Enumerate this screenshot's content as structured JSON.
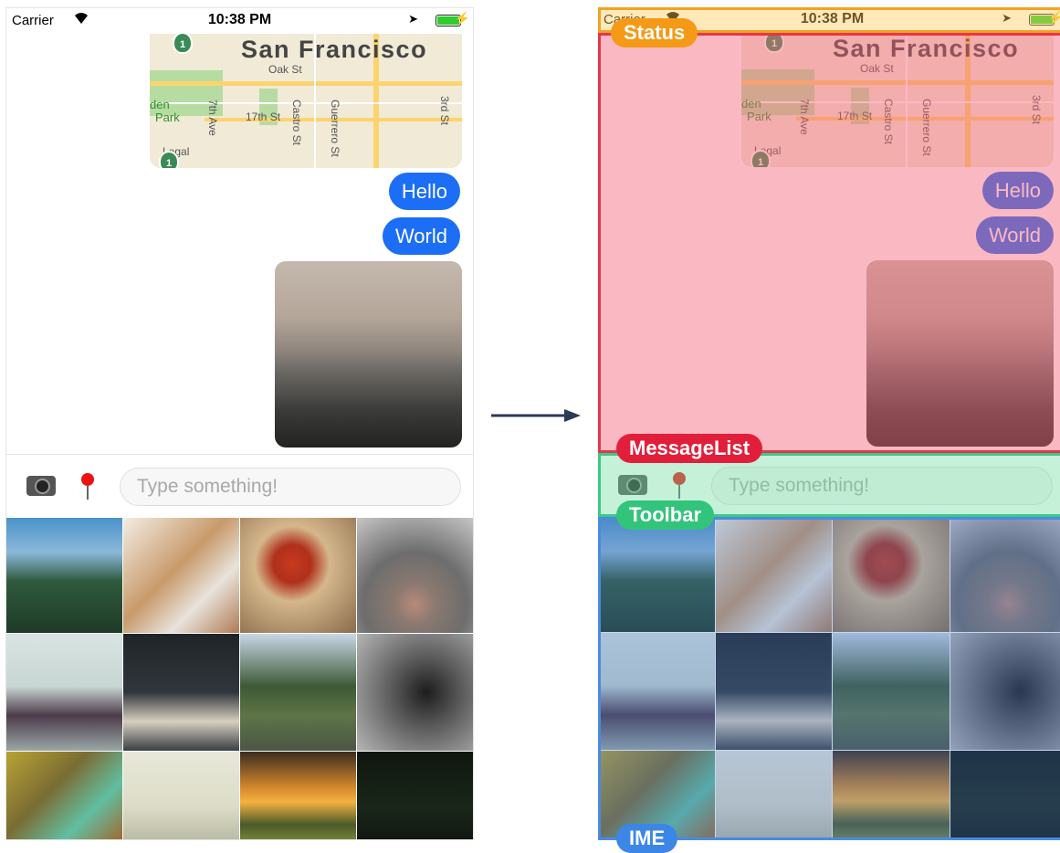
{
  "status": {
    "carrier": "Carrier",
    "time": "10:38 PM",
    "bolt": "⚡",
    "location_glyph": "➤"
  },
  "map": {
    "city": "San Francisco",
    "labels": {
      "oak": "Oak St",
      "seventeenth": "17th St",
      "seventh": "7th Ave",
      "castro": "Castro St",
      "guerrero": "Guerrero St",
      "third": "3rd St",
      "den": "den",
      "park": "Park",
      "legal": "Legal"
    },
    "shield": "1"
  },
  "messages": [
    {
      "text": "Hello"
    },
    {
      "text": "World"
    }
  ],
  "toolbar": {
    "placeholder": "Type something!"
  },
  "overlay_labels": {
    "status": "Status",
    "message_list": "MessageList",
    "toolbar": "Toolbar",
    "ime": "IME"
  },
  "colors": {
    "bubble": "#1b6ef5",
    "status_overlay": "#f49a17",
    "message_overlay": "#e21f3b",
    "toolbar_overlay": "#33c47c",
    "ime_overlay": "#3c86e6",
    "arrow": "#2b3a55"
  },
  "gallery_tiles": [
    "forest-landscape",
    "desk-with-books",
    "red-mug",
    "cat-nose",
    "boat-and-birds",
    "keyboard-desk",
    "tree-lined-road",
    "pine-cone",
    "colorful-clothespins",
    "foggy-field",
    "sunset-landscape",
    "dark-night"
  ]
}
